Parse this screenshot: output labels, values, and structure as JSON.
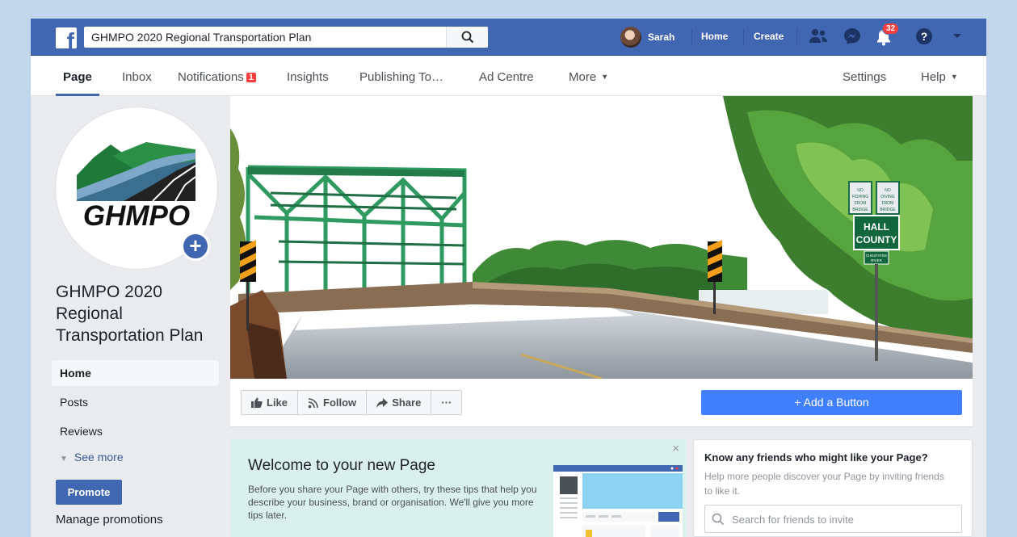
{
  "topbar": {
    "search_value": "GHMPO 2020 Regional Transportation Plan",
    "user_name": "Sarah",
    "home": "Home",
    "create": "Create",
    "notifications_count": "32"
  },
  "page_nav": {
    "page": "Page",
    "inbox": "Inbox",
    "notifications": "Notifications",
    "notifications_badge": "1",
    "insights": "Insights",
    "publishing_tools": "Publishing To…",
    "ad_centre": "Ad Centre",
    "more": "More",
    "settings": "Settings",
    "help": "Help"
  },
  "profile": {
    "logo_text": "GHMPO",
    "page_name": "GHMPO 2020 Regional Transportation Plan"
  },
  "left_nav": {
    "items": [
      "Home",
      "Posts",
      "Reviews"
    ],
    "see_more": "See more",
    "promote": "Promote",
    "manage_promotions": "Manage promotions"
  },
  "cover": {
    "sign_main": "HALL COUNTY",
    "sign_no_fishing": "NO FISHING FROM BRIDGE",
    "sign_no_diving": "NO DIVING FROM BRIDGE",
    "sign_river": "CHESTATEE RIVER"
  },
  "actions": {
    "like": "Like",
    "follow": "Follow",
    "share": "Share",
    "more": "···",
    "add_button": "+ Add a Button"
  },
  "welcome": {
    "title": "Welcome to your new Page",
    "body": "Before you share your Page with others, try these tips that help you describe your business, brand or organisation. We'll give you more tips later.",
    "close": "×"
  },
  "friends_card": {
    "title": "Know any friends who might like your Page?",
    "subtitle": "Help more people discover your Page by inviting friends to like it.",
    "search_placeholder": "Search for friends to invite"
  },
  "colors": {
    "facebook_blue": "#4267b2",
    "button_blue": "#4080ff",
    "badge_red": "#fa3e3e",
    "welcome_bg": "#d9f0ec"
  }
}
